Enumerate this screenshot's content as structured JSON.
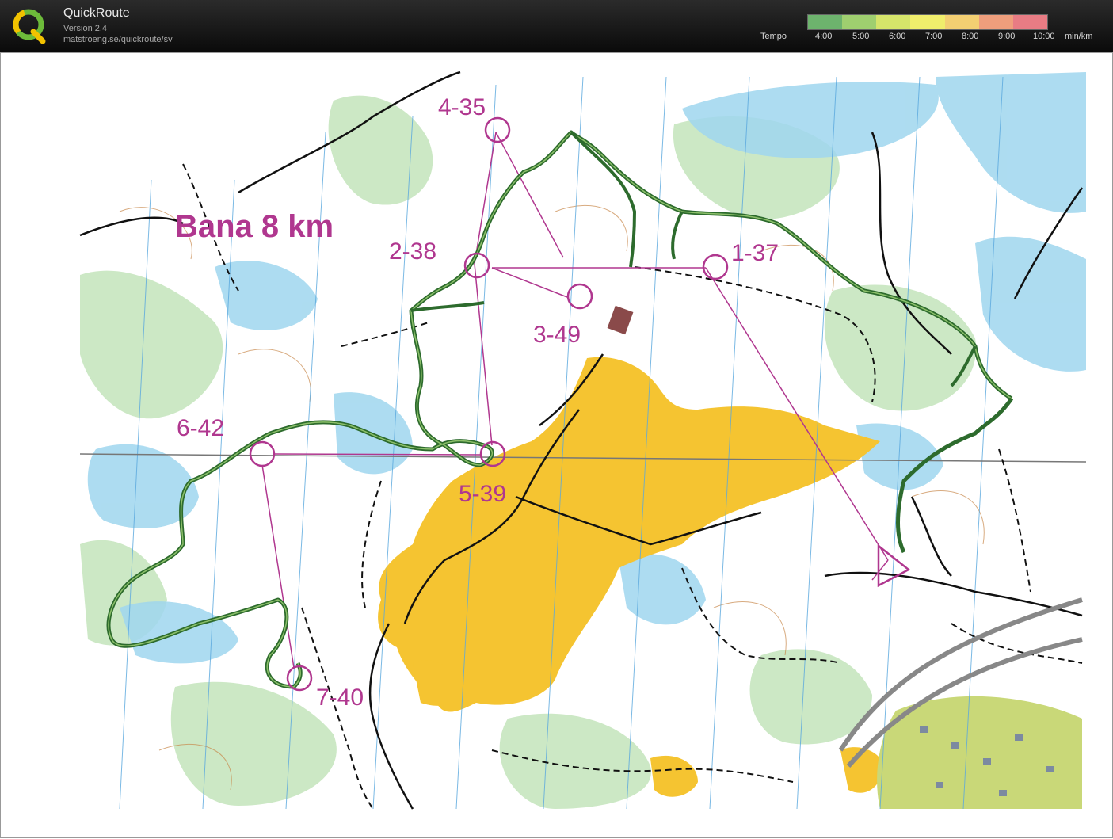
{
  "app": {
    "name": "QuickRoute",
    "version": "Version 2.4",
    "url": "matstroeng.se/quickroute/sv"
  },
  "legend": {
    "label": "Tempo",
    "ticks": [
      "4:00",
      "5:00",
      "6:00",
      "7:00",
      "8:00",
      "9:00",
      "10:00"
    ],
    "unit": "min/km",
    "gradient_colors": [
      "#6db36d",
      "#9fcf6f",
      "#d5e46a",
      "#f0ee6c",
      "#f3cf72",
      "#ef9e7c",
      "#e87c84"
    ]
  },
  "map": {
    "title": "Bana 8 km",
    "controls": [
      {
        "label": "1-37"
      },
      {
        "label": "2-38"
      },
      {
        "label": "3-49"
      },
      {
        "label": "4-35"
      },
      {
        "label": "5-39"
      },
      {
        "label": "6-42"
      },
      {
        "label": "7-40"
      }
    ],
    "colors": {
      "course": "#b0378f",
      "route": "#2d6b2d",
      "field": "#f5c431",
      "water": "#8fd0ec",
      "forest": "#c9e6c2"
    }
  }
}
